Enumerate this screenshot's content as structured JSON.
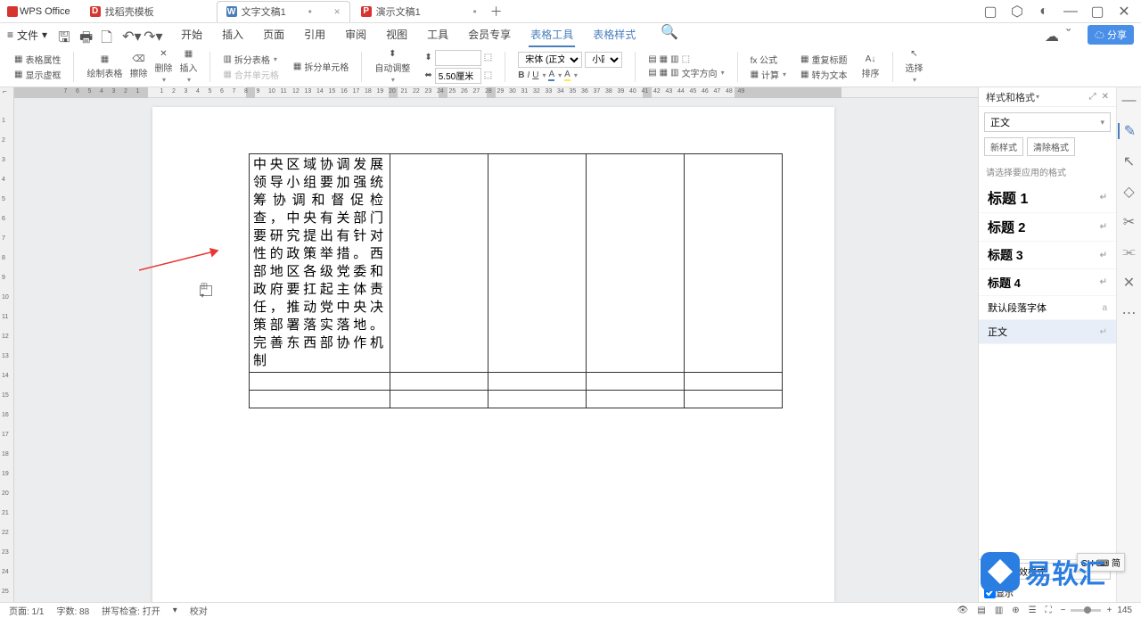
{
  "app": {
    "name": "WPS Office"
  },
  "tabs": [
    {
      "label": "找稻壳模板",
      "icon_color": "#d6352f"
    },
    {
      "label": "文字文稿1",
      "icon_letter": "W",
      "icon_color": "#4a7ebb",
      "active": true,
      "dirty": "•"
    },
    {
      "label": "演示文稿1",
      "icon_letter": "P",
      "icon_color": "#d6352f",
      "dirty": "•"
    }
  ],
  "menu": {
    "file": "文件",
    "items": [
      "开始",
      "插入",
      "页面",
      "引用",
      "审阅",
      "视图",
      "工具",
      "会员专享",
      "表格工具",
      "表格样式"
    ],
    "active_index": 8,
    "share": "分享"
  },
  "ribbon": {
    "table_props": "表格属性",
    "show_grid": "显示虚框",
    "draw_table": "绘制表格",
    "erase": "擦除",
    "delete": "删除",
    "insert": "插入",
    "split_table": "拆分表格",
    "merge_cells": "合并单元格",
    "split_cells": "拆分单元格",
    "autofit": "自动调整",
    "height_icon": "⬍",
    "width_icon": "⬌",
    "width_val": "5.50厘米",
    "font": "宋体 (正文)",
    "size": "小四",
    "align": "对齐",
    "text_dir": "文字方向",
    "formula": "fx 公式",
    "repeat_header": "重复标题",
    "calc": "计算",
    "to_text": "转为文本",
    "sort": "排序",
    "select": "选择"
  },
  "doc": {
    "cell_text": "中央区域协调发展领导小组要加强统筹协调和督促检查，中央有关部门要研究提出有针对性的政策举措。西部地区各级党委和政府要扛起主体责任，推动党中央决策部署落实落地。完善东西部协作机制",
    "handle": "田 ▾"
  },
  "rpanel": {
    "title": "样式和格式",
    "current": "正文",
    "new_style": "新样式",
    "clear": "清除格式",
    "hint": "请选择要应用的格式",
    "styles": [
      {
        "label": "标题 1",
        "cls": "h1"
      },
      {
        "label": "标题 2",
        "cls": "h2"
      },
      {
        "label": "标题 3",
        "cls": "h3"
      },
      {
        "label": "标题 4",
        "cls": "h4"
      },
      {
        "label": "默认段落字体",
        "cls": ""
      },
      {
        "label": "正文",
        "cls": "sel"
      }
    ],
    "show": "显示",
    "show_sel": "有效样式",
    "show2": "显示"
  },
  "status": {
    "page": "页面: 1/1",
    "words": "字数: 88",
    "spell": "拼写检查: 打开",
    "proof": "校对",
    "zoom": "145",
    "ime": "CH ⌨ 简"
  },
  "watermark": "易软汇"
}
